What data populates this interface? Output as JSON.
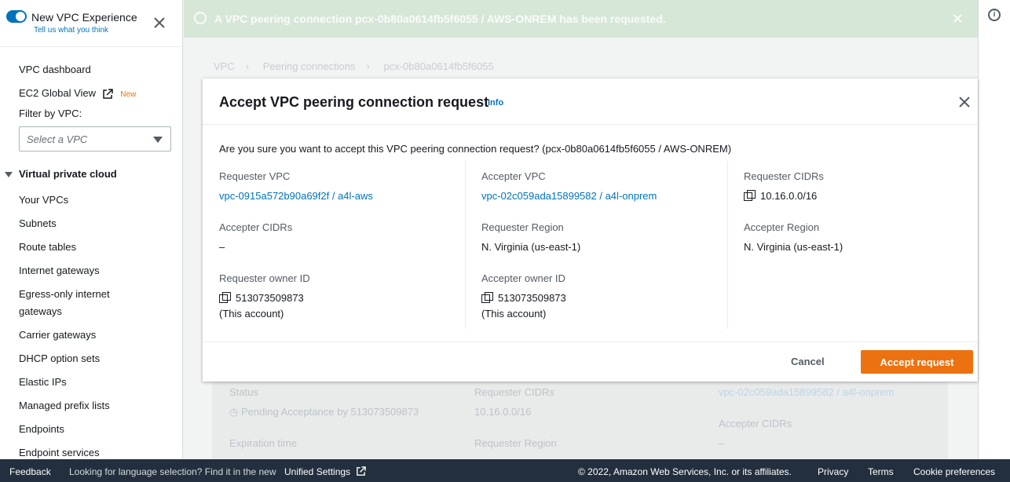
{
  "sidebar": {
    "title": "New VPC Experience",
    "subtitle": "Tell us what you think",
    "dashboard": "VPC dashboard",
    "global_view": "EC2 Global View",
    "new_badge": "New",
    "filter_label": "Filter by VPC:",
    "filter_placeholder": "Select a VPC",
    "section": "Virtual private cloud",
    "items": [
      "Your VPCs",
      "Subnets",
      "Route tables",
      "Internet gateways",
      "Egress-only internet",
      "gateways",
      "Carrier gateways",
      "DHCP option sets",
      "Elastic IPs",
      "Managed prefix lists",
      "Endpoints",
      "Endpoint services"
    ]
  },
  "flash": {
    "message": "A VPC peering connection pcx-0b80a0614fb5f6055 / AWS-ONREM has been requested."
  },
  "breadcrumb": [
    "VPC",
    "Peering connections",
    "pcx-0b80a0614fb5f6055"
  ],
  "background": {
    "status_label": "Status",
    "status_value": "Pending Acceptance by 513073509873",
    "expiration_label": "Expiration time",
    "req_cidrs_label": "Requester CIDRs",
    "req_cidrs_value": "10.16.0.0/16",
    "req_region_label": "Requester Region",
    "accepter_vpc_value": "vpc-02c059ada15899582 / a4l-onprem",
    "acc_cidrs_label": "Accepter CIDRs",
    "acc_cidrs_value": "–"
  },
  "modal": {
    "title": "Accept VPC peering connection request",
    "info": "Info",
    "question": "Are you sure you want to accept this VPC peering connection request? (pcx-0b80a0614fb5f6055 / AWS-ONREM)",
    "requester_vpc_label": "Requester VPC",
    "requester_vpc_value": "vpc-0915a572b90a69f2f / a4l-aws",
    "accepter_vpc_label": "Accepter VPC",
    "accepter_vpc_value": "vpc-02c059ada15899582 / a4l-onprem",
    "requester_cidrs_label": "Requester CIDRs",
    "requester_cidrs_value": "10.16.0.0/16",
    "accepter_cidrs_label": "Accepter CIDRs",
    "accepter_cidrs_value": "–",
    "requester_region_label": "Requester Region",
    "requester_region_value": "N. Virginia (us-east-1)",
    "accepter_region_label": "Accepter Region",
    "accepter_region_value": "N. Virginia (us-east-1)",
    "requester_owner_label": "Requester owner ID",
    "requester_owner_value": "513073509873",
    "requester_owner_note": "(This account)",
    "accepter_owner_label": "Accepter owner ID",
    "accepter_owner_value": "513073509873",
    "accepter_owner_note": "(This account)",
    "cancel": "Cancel",
    "accept": "Accept request"
  },
  "footer": {
    "feedback": "Feedback",
    "language": "Looking for language selection? Find it in the new",
    "unified": "Unified Settings",
    "copyright": "© 2022, Amazon Web Services, Inc. or its affiliates.",
    "privacy": "Privacy",
    "terms": "Terms",
    "cookies": "Cookie preferences"
  },
  "colors": {
    "accent": "#0073bb",
    "primary_button": "#ec7211",
    "footer_bg": "#232f3e",
    "flash_bg": "#d6e6d7"
  },
  "icons": [
    "close-icon",
    "external-link-icon",
    "copy-icon",
    "info-icon",
    "success-icon",
    "caret-down-icon"
  ]
}
